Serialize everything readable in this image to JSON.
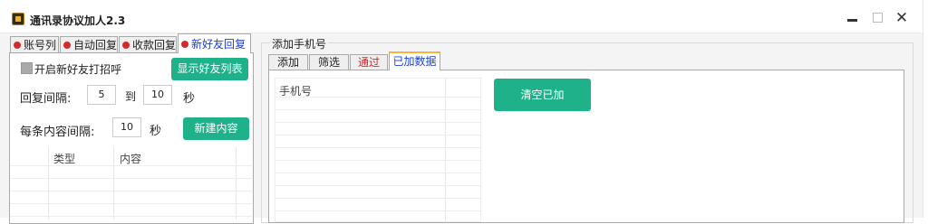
{
  "window": {
    "title": "通讯录协议加人2.3",
    "controls": [
      "minimize-icon",
      "maximize-icon",
      "close-icon"
    ],
    "close_glyph": "✕"
  },
  "left_tabs": [
    {
      "label": "账号列",
      "active": false
    },
    {
      "label": "自动回复",
      "active": false
    },
    {
      "label": "收款回复",
      "active": false
    },
    {
      "label": "新好友回复",
      "active": true
    }
  ],
  "new_friend_panel": {
    "enable_greeting_label": "开启新好友打招呼",
    "enable_greeting_checked": false,
    "show_friends_button": "显示好友列表",
    "reply_interval_label": "回复间隔:",
    "reply_interval_from": "5",
    "to_label": "到",
    "reply_interval_to": "10",
    "seconds_label": "秒",
    "item_interval_label": "每条内容间隔:",
    "item_interval_value": "10",
    "item_seconds_label": "秒",
    "new_content_button": "新建内容",
    "table": {
      "columns": [
        "类型",
        "内容"
      ],
      "rows": []
    }
  },
  "add_phone_group": {
    "label": "添加手机号",
    "tabs": [
      {
        "label": "添加",
        "active": false,
        "color": "#222222"
      },
      {
        "label": "筛选",
        "active": false,
        "color": "#222222"
      },
      {
        "label": "通过",
        "active": false,
        "color": "#e02020"
      },
      {
        "label": "已加数据",
        "active": true,
        "color": "#1a3fd0"
      }
    ],
    "table": {
      "columns": [
        "手机号"
      ],
      "rows": []
    },
    "clear_button": "清空已加"
  },
  "colors": {
    "accent_green": "#1fb28a",
    "tab_dot_red": "#d42a2a",
    "active_tab_blue": "#1a3fd0",
    "active_tab_top": "#f3b63d"
  }
}
